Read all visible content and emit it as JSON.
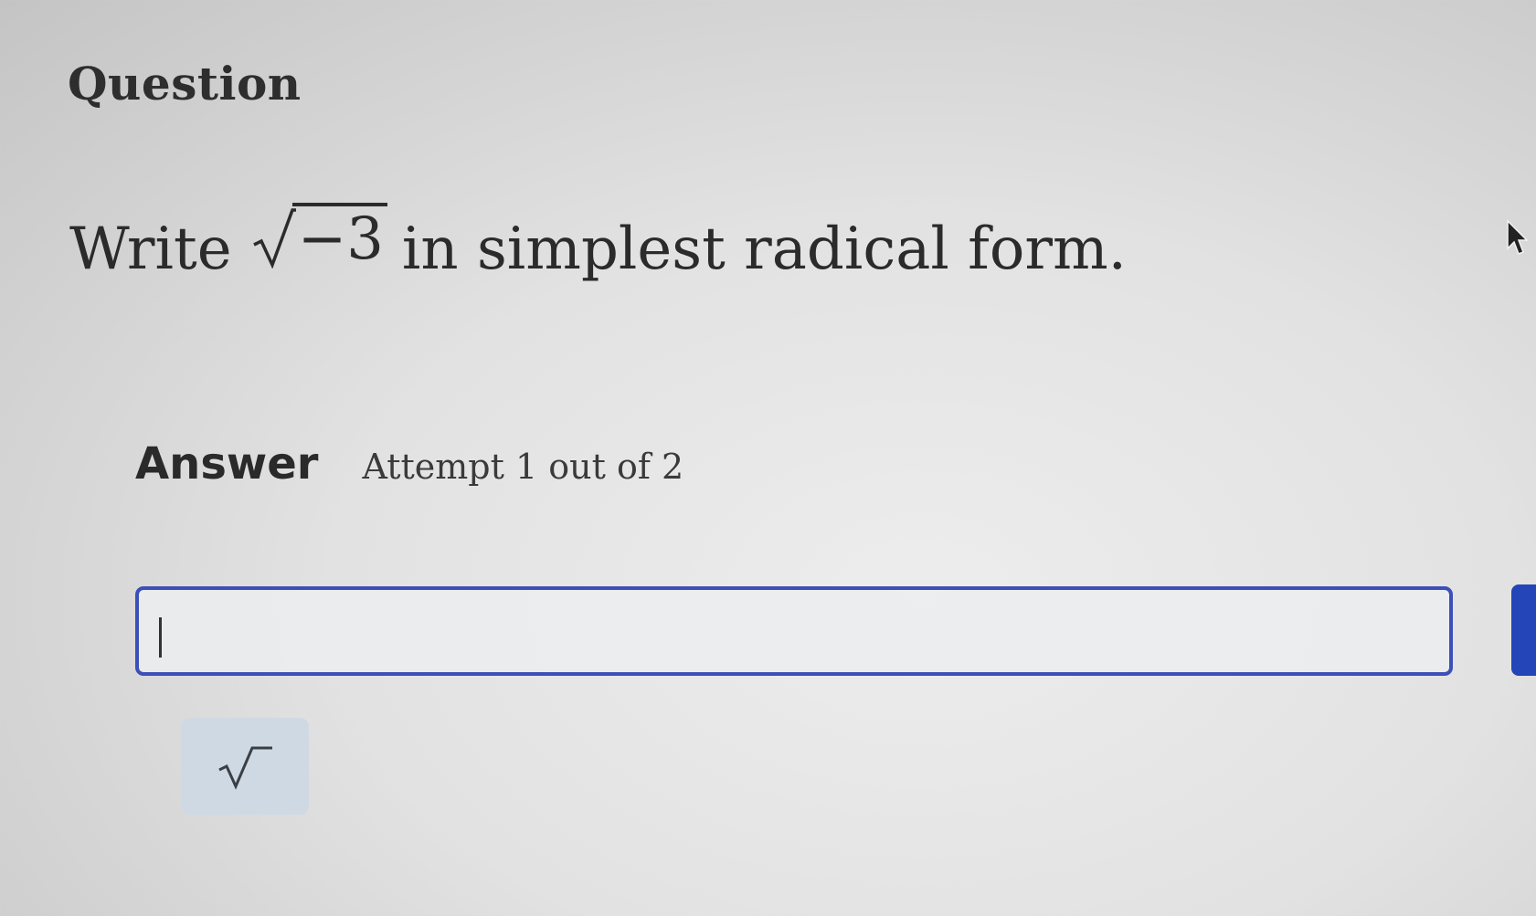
{
  "question": {
    "heading": "Question",
    "prompt_prefix": "Write",
    "radicand": "−3",
    "prompt_suffix": "in simplest radical form."
  },
  "answer": {
    "label": "Answer",
    "attempt_text": "Attempt 1 out of 2",
    "input_value": ""
  },
  "toolbar": {
    "sqrt_icon": "square-root-icon"
  },
  "colors": {
    "input_border": "#3d4fb8",
    "submit_button": "#2345b8",
    "sqrt_button_bg": "#cfd9e3"
  }
}
